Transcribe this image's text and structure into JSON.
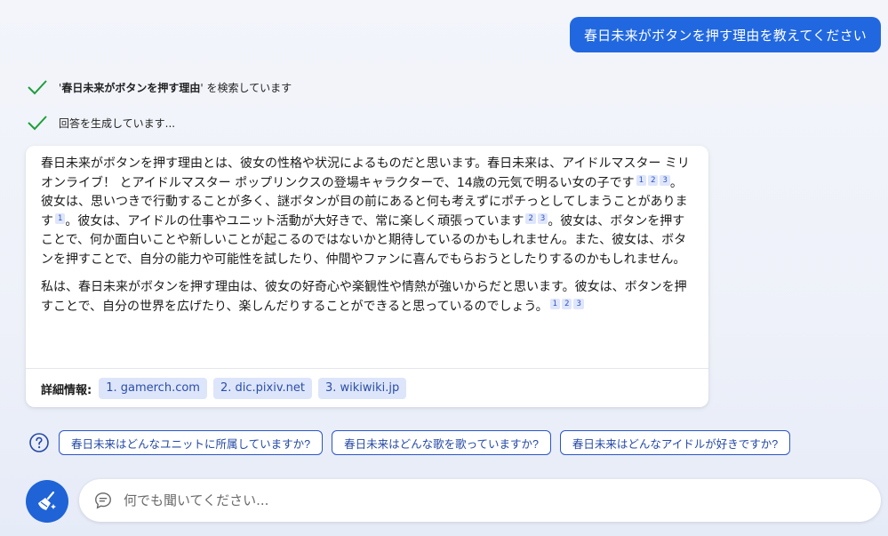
{
  "user_message": "春日未来がボタンを押す理由を教えてください",
  "status": {
    "search_prefix": "'",
    "search_query": "春日未来がボタンを押す理由",
    "search_suffix": "' を検索しています",
    "generating": "回答を生成しています..."
  },
  "answer": {
    "p1_parts": [
      "春日未来がボタンを押す理由とは、彼女の性格や状況によるものだと思います。春日未来は、アイドルマスター ミリオンライブ！ とアイドルマスター ポップリンクスの登場キャラクターで、14歳の元気で明るい女の子です",
      "。彼女は、思いつきで行動することが多く、謎ボタンが目の前にあると何も考えずにポチっとしてしまうことがあります",
      "。彼女は、アイドルの仕事やユニット活動が大好きで、常に楽しく頑張っています",
      "。彼女は、ボタンを押すことで、何か面白いことや新しいことが起こるのではないかと期待しているのかもしれません。また、彼女は、ボタンを押すことで、自分の能力や可能性を試したり、仲間やファンに喜んでもらおうとしたりするのかもしれません。"
    ],
    "p2_text": "私は、春日未来がボタンを押す理由は、彼女の好奇心や楽観性や情熱が強いからだと思います。彼女は、ボタンを押すことで、自分の世界を広げたり、楽しんだりすることができると思っているのでしょう。",
    "cite_1": "1",
    "cite_2": "2",
    "cite_3": "3"
  },
  "sources": {
    "label": "詳細情報:",
    "items": [
      "1. gamerch.com",
      "2. dic.pixiv.net",
      "3. wikiwiki.jp"
    ]
  },
  "suggestions": [
    "春日未来はどんなユニットに所属していますか?",
    "春日未来はどんな歌を歌っていますか?",
    "春日未来はどんなアイドルが好きですか?"
  ],
  "input": {
    "placeholder": "何でも聞いてください..."
  },
  "colors": {
    "accent": "#2168e0",
    "check": "#1e9e3a",
    "chip_bg": "#dde5fa"
  },
  "icons": {
    "status": "check-icon",
    "suggestion_help": "question-circle-icon",
    "new_topic": "broom-icon",
    "input": "chat-bubble-icon"
  }
}
